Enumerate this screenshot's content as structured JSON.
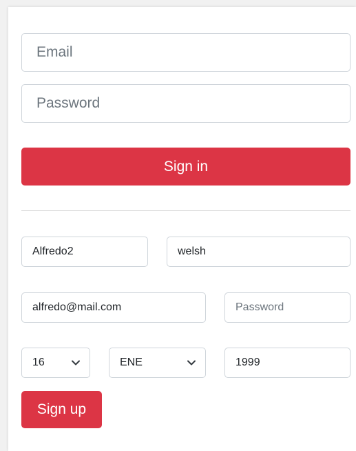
{
  "signin": {
    "email_placeholder": "Email",
    "password_placeholder": "Password",
    "submit_label": "Sign in"
  },
  "signup": {
    "first_name_value": "Alfredo2",
    "last_name_value": "welsh",
    "email_value": "alfredo@mail.com",
    "password_placeholder": "Password",
    "day_selected": "16",
    "month_selected": "ENE",
    "year_value": "1999",
    "submit_label": "Sign up"
  },
  "colors": {
    "primary_button": "#dc3545",
    "input_border": "#ced4da",
    "placeholder_text": "#6c757d"
  },
  "icons": {
    "select_arrow": "chevron-down-icon"
  }
}
